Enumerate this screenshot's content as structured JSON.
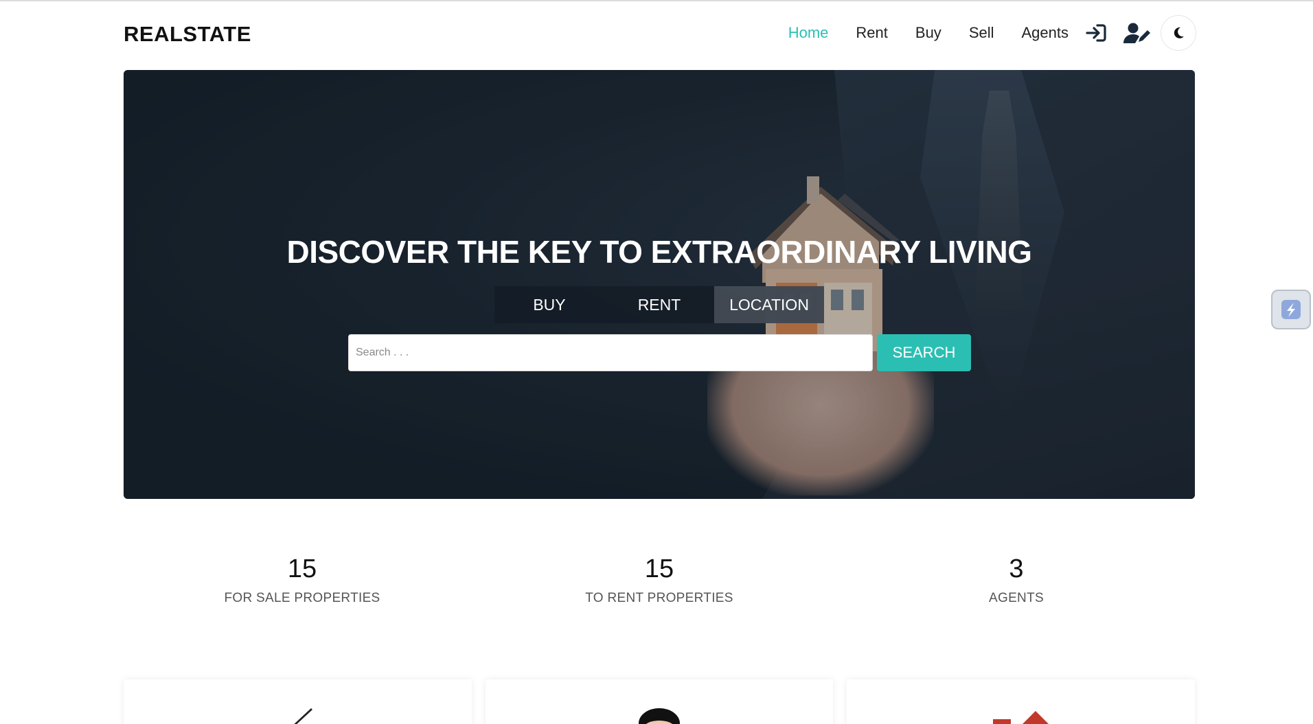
{
  "brand": "REALSTATE",
  "nav": {
    "items": [
      {
        "label": "Home",
        "active": true
      },
      {
        "label": "Rent",
        "active": false
      },
      {
        "label": "Buy",
        "active": false
      },
      {
        "label": "Sell",
        "active": false
      },
      {
        "label": "Agents",
        "active": false
      }
    ],
    "login_icon": "sign-in-icon",
    "register_icon": "user-edit-icon",
    "theme_icon": "moon-icon"
  },
  "hero": {
    "title": "DISCOVER THE KEY TO EXTRAORDINARY LIVING",
    "tabs": [
      {
        "label": "BUY",
        "active": false
      },
      {
        "label": "RENT",
        "active": false
      },
      {
        "label": "LOCATION",
        "active": true
      }
    ],
    "search": {
      "placeholder": "Search . . .",
      "value": "",
      "button": "SEARCH"
    }
  },
  "stats": [
    {
      "value": "15",
      "label": "FOR SALE PROPERTIES"
    },
    {
      "value": "15",
      "label": "TO RENT PROPERTIES"
    },
    {
      "value": "3",
      "label": "AGENTS"
    }
  ],
  "colors": {
    "accent": "#2bbfb3",
    "hero_dark": "#1d2935"
  },
  "side_widget_icon": "lightning-icon"
}
